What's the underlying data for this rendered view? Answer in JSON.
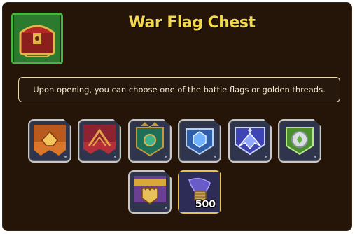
{
  "dialog": {
    "title": "War Flag Chest",
    "description": "Upon opening, you can choose one of the battle flags or golden threads."
  },
  "items": [
    {
      "name": "battle-flag-orange",
      "color": "#d9762b"
    },
    {
      "name": "battle-flag-crimson",
      "color": "#b32f3a"
    },
    {
      "name": "battle-flag-emerald",
      "color": "#2d8f6a"
    },
    {
      "name": "battle-flag-blue",
      "color": "#3a73c4"
    },
    {
      "name": "battle-flag-violet",
      "color": "#4d52c8"
    },
    {
      "name": "battle-flag-green",
      "color": "#62b23f"
    },
    {
      "name": "battle-flag-purple-gold",
      "color": "#7b4fa3"
    },
    {
      "name": "golden-threads",
      "color": "#e9c44a",
      "quantity": "500"
    }
  ]
}
